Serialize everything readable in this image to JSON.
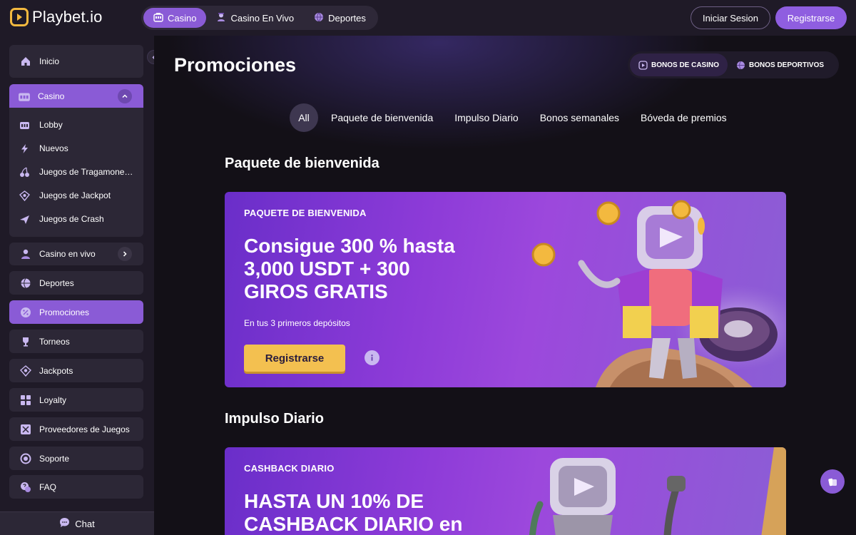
{
  "brand": {
    "name": "Playbet.io",
    "accent": "#f3b93f",
    "purple": "#8a5bd6"
  },
  "topnav": [
    {
      "label": "Casino",
      "icon": "slot-machine-icon",
      "active": true
    },
    {
      "label": "Casino En Vivo",
      "icon": "dealer-icon",
      "active": false
    },
    {
      "label": "Deportes",
      "icon": "ball-icon",
      "active": false
    }
  ],
  "auth": {
    "login_label": "Iniciar Sesion",
    "register_label": "Registrarse"
  },
  "sidebar": {
    "home": "Inicio",
    "casino": {
      "label": "Casino",
      "items": [
        "Lobby",
        "Nuevos",
        "Juegos de Tragamone…",
        "Juegos de Jackpot",
        "Juegos de Crash"
      ]
    },
    "live_casino": "Casino en vivo",
    "items": [
      "Deportes",
      "Promociones",
      "Torneos",
      "Jackpots",
      "Loyalty",
      "Proveedores de Juegos",
      "Soporte",
      "FAQ"
    ],
    "active_item": "Promociones",
    "chat": "Chat"
  },
  "main": {
    "title": "Promociones",
    "bonus_tabs": [
      {
        "label": "BONOS DE CASINO",
        "active": true
      },
      {
        "label": "BONOS DEPORTIVOS",
        "active": false
      }
    ],
    "filters": [
      {
        "label": "All",
        "active": true
      },
      {
        "label": "Paquete de bienvenida",
        "active": false
      },
      {
        "label": "Impulso Diario",
        "active": false
      },
      {
        "label": "Bonos semanales",
        "active": false
      },
      {
        "label": "Bóveda de premios",
        "active": false
      }
    ],
    "sections": [
      {
        "title": "Paquete de bienvenida",
        "card": {
          "tag": "PAQUETE DE BIENVENIDA",
          "headline": "Consigue 300 % hasta 3,000 USDT + 300 GIROS GRATIS",
          "subtext": "En tus 3 primeros depósitos",
          "cta": "Registrarse"
        }
      },
      {
        "title": "Impulso Diario",
        "card": {
          "tag": "CASHBACK DIARIO",
          "headline": "HASTA UN 10% DE CASHBACK DIARIO en"
        }
      }
    ]
  }
}
